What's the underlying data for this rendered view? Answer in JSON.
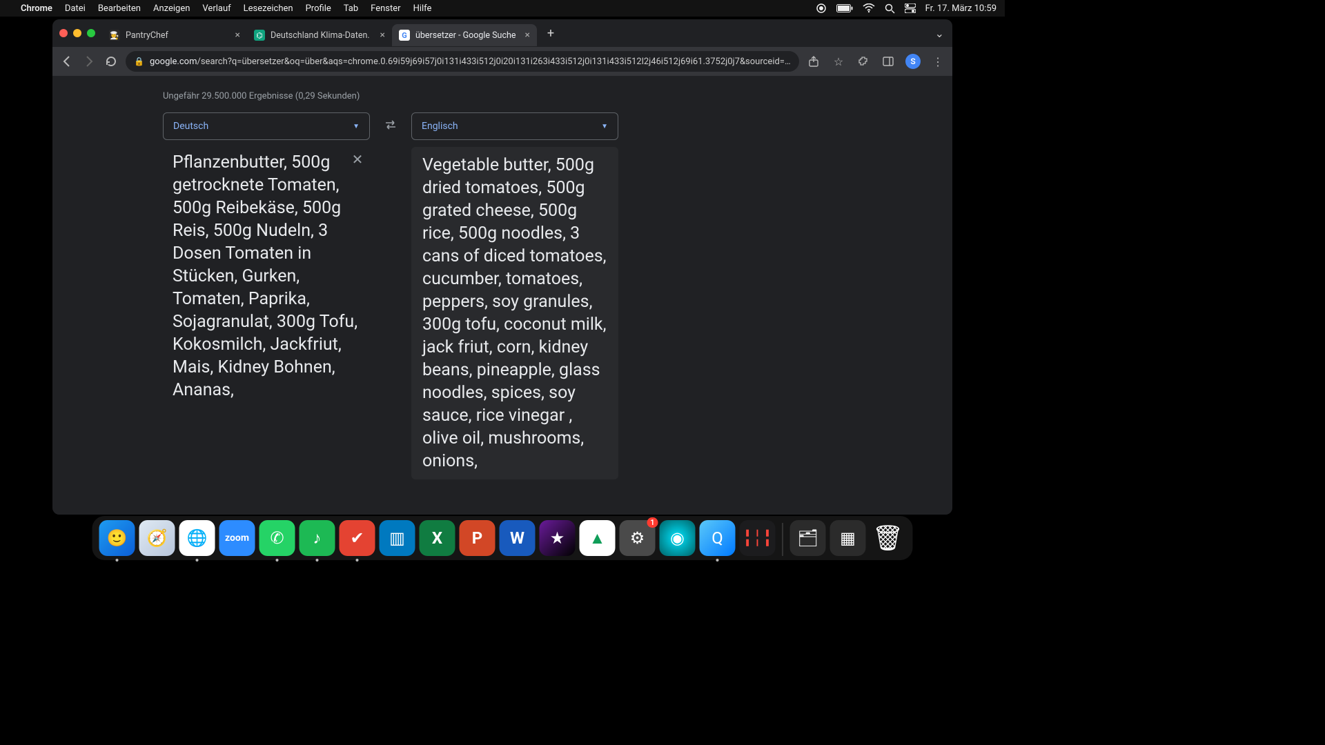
{
  "menubar": {
    "app_name": "Chrome",
    "items": [
      "Datei",
      "Bearbeiten",
      "Anzeigen",
      "Verlauf",
      "Lesezeichen",
      "Profile",
      "Tab",
      "Fenster",
      "Hilfe"
    ],
    "clock": "Fr. 17. März  10:59"
  },
  "browser": {
    "tabs": [
      {
        "title": "PantryChef",
        "favicon": "🧑‍🍳",
        "active": false
      },
      {
        "title": "Deutschland Klima-Daten.",
        "favicon": "💬",
        "active": false
      },
      {
        "title": "übersetzer - Google Suche",
        "favicon": "G",
        "active": true
      }
    ],
    "url_host": "google.com",
    "url_rest": "/search?q=übersetzer&oq=über&aqs=chrome.0.69i59j69i57j0i131i433i512j0i20i131i263i433i512j0i131i433i512l2j46i512j69i61.3752j0j7&sourceid=chro…",
    "avatar_letter": "S"
  },
  "page": {
    "result_stats": "Ungefähr 29.500.000 Ergebnisse (0,29 Sekunden)",
    "translator": {
      "src_lang": "Deutsch",
      "dst_lang": "Englisch",
      "src_text": "Pflanzenbutter, 500g getrocknete Tomaten, 500g Reibekäse, 500g Reis, 500g Nudeln, 3 Dosen Tomaten in Stücken, Gurken, Tomaten, Paprika, Sojagranulat, 300g Tofu, Kokosmilch, Jackfriut, Mais, Kidney Bohnen, Ananas,",
      "dst_text": "Vegetable butter, 500g dried tomatoes, 500g grated cheese, 500g rice, 500g noodles, 3 cans of diced tomatoes, cucumber, tomatoes, peppers, soy granules, 300g tofu, coconut milk, jack friut, corn, kidney beans, pineapple, glass noodles, spices, soy sauce, rice vinegar , olive oil, mushrooms, onions,"
    }
  },
  "dock": {
    "badge_label": "1"
  }
}
